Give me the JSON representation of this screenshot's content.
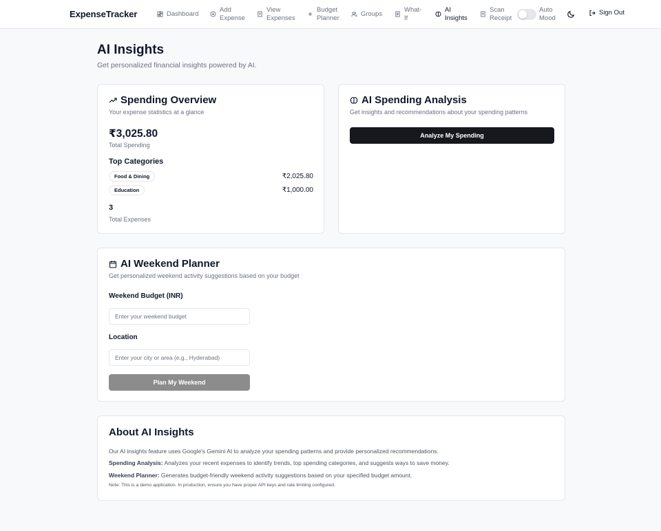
{
  "app": {
    "brand": "ExpenseTracker",
    "accent_color": "#16181d",
    "muted_text_color": "#6b7280"
  },
  "nav": {
    "items": [
      {
        "label": "Dashboard",
        "icon": "dashboard-icon",
        "active": false
      },
      {
        "label": "Add Expense",
        "icon": "plus-circle-icon",
        "active": false
      },
      {
        "label": "View Expenses",
        "icon": "receipt-icon",
        "active": false
      },
      {
        "label": "Budget Planner",
        "icon": "circle-dot-icon",
        "active": false
      },
      {
        "label": "Groups",
        "icon": "users-icon",
        "active": false
      },
      {
        "label": "What-If",
        "icon": "document-icon",
        "active": false
      },
      {
        "label": "AI Insights",
        "icon": "brain-icon",
        "active": true
      },
      {
        "label": "Scan Receipt",
        "icon": "scan-icon",
        "active": false
      }
    ],
    "auto_mood_label": "Auto Mood",
    "auto_mood_on": false,
    "theme_icon": "moon-icon",
    "signout_label": "Sign Out"
  },
  "page": {
    "title": "AI Insights",
    "subtitle": "Get personalized financial insights powered by AI."
  },
  "overview": {
    "title": "Spending Overview",
    "description": "Your expense statistics at a glance",
    "total_amount": "₹3,025.80",
    "total_label": "Total Spending",
    "top_categories_title": "Top Categories",
    "categories": [
      {
        "name": "Food & Dining",
        "amount": "₹2,025.80"
      },
      {
        "name": "Education",
        "amount": "₹1,000.00"
      }
    ],
    "expense_count": "3",
    "expense_count_label": "Total Expenses"
  },
  "analysis": {
    "title": "AI Spending Analysis",
    "description": "Get insights and recommendations about your spending patterns",
    "button_label": "Analyze My Spending"
  },
  "weekend": {
    "title": "AI Weekend Planner",
    "description": "Get personalized weekend activity suggestions based on your budget",
    "budget_label": "Weekend Budget (INR)",
    "budget_placeholder": "Enter your weekend budget",
    "budget_value": "",
    "location_label": "Location",
    "location_placeholder": "Enter your city or area (e.g., Hyderabad)",
    "location_value": "",
    "button_label": "Plan My Weekend"
  },
  "about": {
    "title": "About AI Insights",
    "intro": "Our AI insights feature uses Google's Gemini AI to analyze your spending patterns and provide personalized recommendations.",
    "analysis_term": "Spending Analysis:",
    "analysis_text": " Analyzes your recent expenses to identify trends, top spending categories, and suggests ways to save money.",
    "planner_term": "Weekend Planner:",
    "planner_text": " Generates budget-friendly weekend activity suggestions based on your specified budget amount.",
    "note": "Note: This is a demo application. In production, ensure you have proper API keys and rate limiting configured."
  }
}
